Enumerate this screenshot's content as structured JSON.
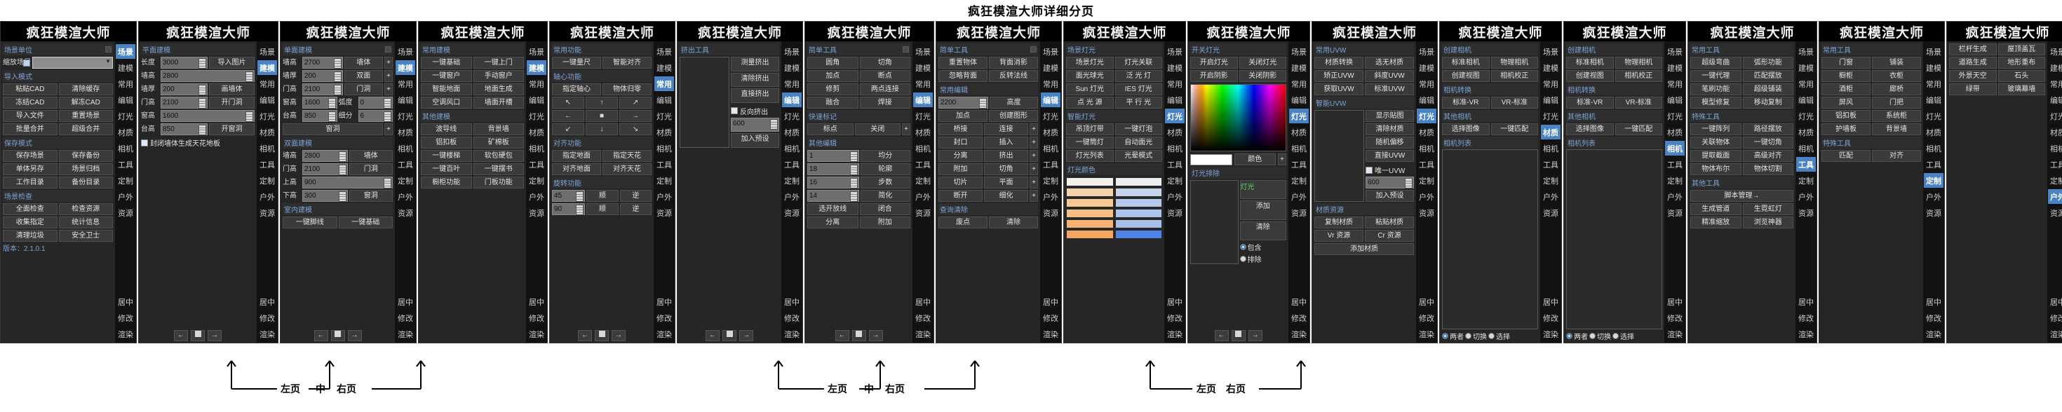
{
  "page_title": "疯狂模渲大师详细分页",
  "app_title": "疯狂模渲大师",
  "rail_tabs": [
    "场景",
    "建模",
    "常用",
    "编辑",
    "灯光",
    "材质",
    "相机",
    "工具",
    "定制",
    "户外",
    "资源"
  ],
  "rail_bottom": [
    "居中",
    "修改",
    "渲染"
  ],
  "nav": {
    "prev": "←",
    "next": "→",
    "stop": "■"
  },
  "callouts": [
    {
      "left": "左页",
      "mid": "中",
      "right": "右页"
    },
    {
      "left": "左页",
      "mid": "中",
      "right": "右页"
    },
    {
      "left": "左页"
    },
    {
      "right": "右页"
    }
  ],
  "callout_labels": {
    "left": "左页",
    "mid": "中",
    "right": "右页"
  },
  "panels": [
    {
      "id": "scene",
      "active_tab": "场景",
      "groups": [
        {
          "type": "header",
          "label": "场景单位",
          "square": true
        },
        {
          "type": "combo",
          "label": "缩放场景",
          "value": ""
        },
        {
          "type": "header",
          "label": "导入模式"
        },
        {
          "type": "buttons",
          "rows": [
            [
              "粘贴CAD",
              "清除缓存"
            ],
            [
              "冻结CAD",
              "解冻CAD"
            ],
            [
              "导入文件",
              "重置场景"
            ],
            [
              "批量合并",
              "超级合并"
            ]
          ]
        },
        {
          "type": "header",
          "label": "保存模式"
        },
        {
          "type": "buttons",
          "rows": [
            [
              "保存场景",
              "保存备份"
            ],
            [
              "单体另存",
              "场景归档"
            ],
            [
              "工作目录",
              "备份目录"
            ]
          ]
        },
        {
          "type": "header",
          "label": "场景检查"
        },
        {
          "type": "buttons",
          "rows": [
            [
              "全面检查",
              "检查资源"
            ],
            [
              "收集指定",
              "统计信息"
            ],
            [
              "清理垃圾",
              "安全卫士"
            ]
          ]
        },
        {
          "type": "version",
          "label": "版本：2.1.0.1"
        }
      ]
    },
    {
      "id": "plane-modeling",
      "active_tab": "建模",
      "groups": [
        {
          "type": "header",
          "label": "平面建模"
        },
        {
          "type": "spin_btn",
          "label": "长度",
          "value": "3000",
          "button": "导入图片"
        },
        {
          "type": "spin",
          "label": "墙高",
          "value": "2800"
        },
        {
          "type": "spin_btn",
          "label": "墙厚",
          "value": "200",
          "button": "画墙体"
        },
        {
          "type": "spin_btn",
          "label": "门高",
          "value": "2100",
          "button": "开门洞"
        },
        {
          "type": "spin",
          "label": "窗高",
          "value": "1600"
        },
        {
          "type": "spin_btn",
          "label": "台高",
          "value": "850",
          "button": "开窗洞"
        },
        {
          "type": "check",
          "label": "封闭墙体生成天花地板",
          "checked": true
        },
        {
          "type": "nav"
        }
      ]
    },
    {
      "id": "single-face-modeling",
      "active_tab": "建模",
      "groups": [
        {
          "type": "header",
          "label": "单面建模",
          "square": true
        },
        {
          "type": "spin_btn_plus",
          "label": "墙高",
          "value": "2700",
          "button": "墙体"
        },
        {
          "type": "spin_btn_plus",
          "label": "墙厚",
          "value": "200",
          "button": "双面"
        },
        {
          "type": "spin_btn_plus",
          "label": "门高",
          "value": "2100",
          "button": "门洞"
        },
        {
          "type": "spin_pair",
          "label1": "窗高",
          "value1": "1600",
          "label2": "弧度",
          "value2": "0"
        },
        {
          "type": "spin_pair",
          "label1": "台高",
          "value1": "850",
          "label2": "细分",
          "value2": "6"
        },
        {
          "type": "btn_plus",
          "button": "窗洞"
        },
        {
          "type": "header",
          "label": "双面建模"
        },
        {
          "type": "spin_btn",
          "label": "墙高",
          "value": "2800",
          "button": "墙体"
        },
        {
          "type": "spin_btn",
          "label": "门高",
          "value": "2100",
          "button": "门洞"
        },
        {
          "type": "spin",
          "label": "上高",
          "value": "900"
        },
        {
          "type": "spin_btn",
          "label": "下高",
          "value": "300",
          "button": "窗洞"
        },
        {
          "type": "header",
          "label": "室内建模"
        },
        {
          "type": "buttons",
          "rows": [
            [
              "一键脚线",
              "一键基础"
            ]
          ]
        },
        {
          "type": "nav"
        }
      ]
    },
    {
      "id": "common-modeling",
      "active_tab": "建模",
      "groups": [
        {
          "type": "header",
          "label": "常用建模"
        },
        {
          "type": "buttons",
          "rows": [
            [
              "一键基础",
              "一键上门"
            ],
            [
              "一键窗户",
              "手动窗户"
            ],
            [
              "智能地面",
              "地面生成"
            ],
            [
              "空调风口",
              "墙面开槽"
            ]
          ]
        },
        {
          "type": "header",
          "label": "其他建模"
        },
        {
          "type": "buttons",
          "rows": [
            [
              "波导线",
              "背景墙"
            ],
            [
              "铝扣板",
              "矿棉板"
            ],
            [
              "一键楼梯",
              "软包硬包"
            ],
            [
              "一键百叶",
              "一键摆书"
            ],
            [
              "橱柜功能",
              "门板功能"
            ]
          ]
        }
      ]
    },
    {
      "id": "common-functions",
      "active_tab": "常用",
      "groups": [
        {
          "type": "header",
          "label": "常用功能"
        },
        {
          "type": "buttons",
          "rows": [
            [
              "一键量尺",
              "智能对齐"
            ]
          ]
        },
        {
          "type": "header",
          "label": "轴心功能"
        },
        {
          "type": "buttons",
          "rows": [
            [
              "指定轴心",
              "物体归零"
            ]
          ]
        },
        {
          "type": "pad",
          "keys": [
            "↖",
            "↑",
            "↗",
            "←",
            "■",
            "→",
            "↙",
            "↓",
            "↘"
          ]
        },
        {
          "type": "header",
          "label": "对齐功能"
        },
        {
          "type": "buttons",
          "rows": [
            [
              "指定地面",
              "指定天花"
            ],
            [
              "对齐地面",
              "对齐天花"
            ]
          ]
        },
        {
          "type": "header",
          "label": "旋转功能"
        },
        {
          "type": "spin_two_btn",
          "value": "45",
          "b1": "顺",
          "b2": "逆"
        },
        {
          "type": "spin_two_btn",
          "value": "90",
          "b1": "顺",
          "b2": "逆"
        },
        {
          "type": "nav"
        }
      ]
    },
    {
      "id": "extrude-tools",
      "active_tab": "编辑",
      "groups": [
        {
          "type": "header",
          "label": "挤出工具"
        },
        {
          "type": "list_side",
          "buttons": [
            "测量挤出",
            "清除挤出",
            "直接挤出"
          ],
          "check": "反向挤出",
          "value": "600",
          "add": "加入预设"
        },
        {
          "type": "nav"
        }
      ]
    },
    {
      "id": "simple-tools-a",
      "active_tab": "编辑",
      "groups": [
        {
          "type": "header",
          "label": "简单工具",
          "square": true
        },
        {
          "type": "buttons",
          "rows": [
            [
              "圆角",
              "切角"
            ],
            [
              "加点",
              "断点"
            ],
            [
              "修剪",
              "两点连接"
            ],
            [
              "融合",
              "焊接"
            ]
          ]
        },
        {
          "type": "header",
          "label": "快速标记"
        },
        {
          "type": "btn_btn_plus",
          "b1": "标点",
          "b2": "关闭"
        },
        {
          "type": "header",
          "label": "其他编辑"
        },
        {
          "type": "spin_btn2",
          "value": "1",
          "button": "均分"
        },
        {
          "type": "spin_btn2",
          "value": "18",
          "button": "轮廓"
        },
        {
          "type": "spin_btn2",
          "value": "16",
          "button": "步数"
        },
        {
          "type": "spin_btn2",
          "value": "14",
          "button": "简化"
        },
        {
          "type": "buttons",
          "rows": [
            [
              "选开放线",
              "闭合"
            ],
            [
              "分离",
              "附加"
            ]
          ]
        },
        {
          "type": "nav"
        }
      ]
    },
    {
      "id": "simple-tools-b",
      "active_tab": "编辑",
      "groups": [
        {
          "type": "header",
          "label": "简单工具",
          "square": true
        },
        {
          "type": "buttons",
          "rows": [
            [
              "重置物体",
              "背面消影"
            ],
            [
              "忽略背面",
              "反转法线"
            ]
          ]
        },
        {
          "type": "header",
          "label": "常用编辑"
        },
        {
          "type": "spin_btn2",
          "value": "2200",
          "button": "高度"
        },
        {
          "type": "buttons",
          "rows": [
            [
              "加点",
              "创建图形"
            ]
          ]
        },
        {
          "type": "buttons_plus",
          "rows": [
            [
              "桥接",
              "连接"
            ],
            [
              "封口",
              "插入"
            ],
            [
              "分离",
              "挤出"
            ],
            [
              "附加",
              "切角"
            ],
            [
              "切片",
              "平面"
            ],
            [
              "断开",
              "细化"
            ]
          ]
        },
        {
          "type": "header",
          "label": "查询清除"
        },
        {
          "type": "buttons",
          "rows": [
            [
              "废点",
              "清除"
            ]
          ]
        }
      ]
    },
    {
      "id": "scene-lights",
      "active_tab": "灯光",
      "groups": [
        {
          "type": "header",
          "label": "场景灯光"
        },
        {
          "type": "buttons",
          "rows": [
            [
              "场景灯光",
              "灯光关联"
            ],
            [
              "面光球光",
              "泛 光 灯"
            ],
            [
              "Sun 灯光",
              "IES 灯光"
            ],
            [
              "点 光 源",
              "平 行 光"
            ]
          ]
        },
        {
          "type": "header",
          "label": "智能灯光"
        },
        {
          "type": "buttons",
          "rows": [
            [
              "吊顶灯带",
              "一键灯泡"
            ],
            [
              "一键筒灯",
              "自动面光"
            ],
            [
              "灯光列表",
              "光晕模式"
            ]
          ]
        },
        {
          "type": "header",
          "label": "灯光颜色"
        },
        {
          "type": "palette",
          "colors": [
            "#f2f0ed",
            "#eceef0",
            "#f5d0a9",
            "#c6d4ea",
            "#f7c794",
            "#b7c9ec",
            "#f6bf84",
            "#aec3ea",
            "#f5b273",
            "#a8bfe9",
            "#f4a55f",
            "#4f83e8"
          ]
        }
      ]
    },
    {
      "id": "light-switch",
      "active_tab": "灯光",
      "groups": [
        {
          "type": "header",
          "label": "开关灯光"
        },
        {
          "type": "buttons",
          "rows": [
            [
              "开启灯光",
              "关闭灯光"
            ],
            [
              "开启阴影",
              "关闭阴影"
            ]
          ]
        },
        {
          "type": "colorpicker",
          "color_label": "颜色",
          "preview": "#ffffff"
        },
        {
          "type": "header",
          "label": "灯光排除"
        },
        {
          "type": "exclude",
          "tag": "灯光",
          "add": "添加",
          "clear": "清除",
          "r1": "包含",
          "r2": "排除"
        },
        {
          "type": "nav"
        }
      ]
    },
    {
      "id": "uvw",
      "active_tab": "灯光",
      "groups": [
        {
          "type": "header",
          "label": "常用UVW"
        },
        {
          "type": "buttons",
          "rows": [
            [
              "材质转换",
              "选无材质"
            ],
            [
              "矫正UVW",
              "斜度UVW"
            ],
            [
              "获取UVW",
              "标准UVW"
            ]
          ]
        },
        {
          "type": "header",
          "label": "智能UVW"
        },
        {
          "type": "list_side2",
          "buttons": [
            "显示贴图",
            "清除材质",
            "随机偏移",
            "直接UVW"
          ],
          "check": "唯一UVW",
          "value": "600",
          "add": "加入预设"
        },
        {
          "type": "header",
          "label": "材质资源"
        },
        {
          "type": "buttons",
          "rows": [
            [
              "复制材质",
              "粘贴材质"
            ],
            [
              "Vr 资源",
              "Cr 资源"
            ]
          ]
        },
        {
          "type": "buttons",
          "rows": [
            [
              "添加材质"
            ]
          ]
        }
      ]
    },
    {
      "id": "camera",
      "active_tab": "材质",
      "groups": [
        {
          "type": "header",
          "label": "创建相机"
        },
        {
          "type": "buttons",
          "rows": [
            [
              "标准相机",
              "物理相机"
            ],
            [
              "创建视图",
              "相机校正"
            ]
          ]
        },
        {
          "type": "header",
          "label": "相机转换"
        },
        {
          "type": "buttons",
          "rows": [
            [
              "标准-VR",
              "VR-标准"
            ]
          ]
        },
        {
          "type": "header",
          "label": "其他相机"
        },
        {
          "type": "buttons",
          "rows": [
            [
              "选择图像",
              "一键匹配"
            ]
          ]
        },
        {
          "type": "header",
          "label": "相机列表"
        },
        {
          "type": "listtall"
        },
        {
          "type": "radios",
          "items": [
            "两者",
            "切换",
            "选择"
          ]
        }
      ]
    },
    {
      "id": "camera-tools",
      "active_tab": "相机",
      "groups": [
        {
          "type": "header",
          "label": "创建相机"
        },
        {
          "type": "buttons",
          "rows": [
            [
              "标准相机",
              "物理相机"
            ],
            [
              "创建视图",
              "相机校正"
            ]
          ]
        },
        {
          "type": "header",
          "label": "相机转换"
        },
        {
          "type": "buttons",
          "rows": [
            [
              "标准-VR",
              "VR-标准"
            ]
          ]
        },
        {
          "type": "header",
          "label": "其他相机"
        },
        {
          "type": "buttons",
          "rows": [
            [
              "选择图像",
              "一键匹配"
            ]
          ]
        },
        {
          "type": "header",
          "label": "相机列表"
        },
        {
          "type": "listtall"
        },
        {
          "type": "radios",
          "items": [
            "两者",
            "切换",
            "选择"
          ]
        }
      ]
    },
    {
      "id": "tools",
      "active_tab": "工具",
      "groups": [
        {
          "type": "header",
          "label": "常用工具"
        },
        {
          "type": "buttons",
          "rows": [
            [
              "超级弯曲",
              "弧形功能"
            ],
            [
              "一键代理",
              "匹配摆放"
            ],
            [
              "笔刷功能",
              "超级铺装"
            ],
            [
              "模型修复",
              "移动复制"
            ]
          ]
        },
        {
          "type": "header",
          "label": "特殊工具"
        },
        {
          "type": "buttons",
          "rows": [
            [
              "一键阵列",
              "路径摆放"
            ],
            [
              "关联物体",
              "一键切角"
            ],
            [
              "提取截面",
              "高级对齐"
            ],
            [
              "物体布尔",
              "物体切割"
            ]
          ]
        },
        {
          "type": "header",
          "label": "其他工具"
        },
        {
          "type": "buttons",
          "rows": [
            [
              "脚本管理→"
            ]
          ]
        },
        {
          "type": "buttons",
          "rows": [
            [
              "生成管道",
              "生霓虹灯"
            ],
            [
              "精准缩放",
              "浏览神器"
            ]
          ]
        }
      ]
    },
    {
      "id": "custom",
      "active_tab": "定制",
      "groups": [
        {
          "type": "header",
          "label": "常用工具"
        },
        {
          "type": "buttons",
          "rows": [
            [
              "门窗",
              "铺装"
            ],
            [
              "橱柜",
              "衣柜"
            ],
            [
              "酒柜",
              "廊桥"
            ],
            [
              "屏风",
              "门把"
            ],
            [
              "铝扣板",
              "系统柜"
            ],
            [
              "护墙板",
              "背景墙"
            ]
          ]
        },
        {
          "type": "header",
          "label": "特殊工具"
        },
        {
          "type": "buttons",
          "rows": [
            [
              "匹配",
              "对齐"
            ]
          ]
        }
      ]
    },
    {
      "id": "outdoor",
      "active_tab": "户外",
      "groups": [
        {
          "type": "buttons",
          "rows": [
            [
              "栏杆生成",
              "屋顶盖瓦"
            ],
            [
              "道路生成",
              "地形重布"
            ],
            [
              "外景天空",
              "石头"
            ],
            [
              "绿带",
              "玻璃幕墙"
            ]
          ]
        }
      ]
    }
  ]
}
